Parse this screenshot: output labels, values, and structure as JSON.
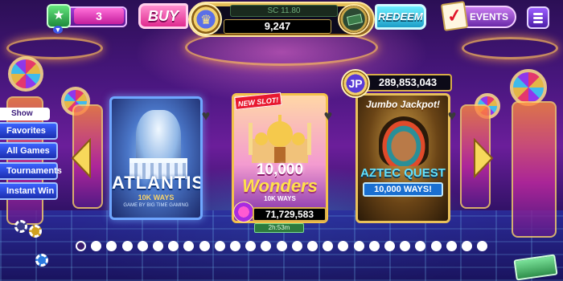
{
  "header": {
    "level": "3",
    "buy_label": "BUY",
    "sc_balance": "SC 11.80",
    "coin_balance": "9,247",
    "redeem_label": "REDEEM",
    "events_label": "EVENTS"
  },
  "side_menu": {
    "show_label": "Show",
    "items": [
      {
        "label": "Favorites"
      },
      {
        "label": "All Games"
      },
      {
        "label": "Tournaments"
      },
      {
        "label": "Instant Win"
      }
    ]
  },
  "games": [
    {
      "title": "ATLANTIS",
      "subtitle": "10K WAYS",
      "brand": "GAME BY BIG TIME GAMING"
    },
    {
      "badge": "NEW SLOT!",
      "title_num": "10,000",
      "title_word": "Wonders",
      "subtitle": "10K WAYS",
      "jackpot": "71,729,583",
      "timer": "2h:53m"
    },
    {
      "jp_badge": "JP",
      "jp_value": "289,853,043",
      "banner": "Jumbo Jackpot!",
      "title": "AZTEC QUEST",
      "subtitle": "10,000 WAYS!"
    }
  ],
  "pagination": {
    "total": 27,
    "active": 0
  },
  "colors": {
    "accent": "#ff3aa8",
    "nav_blue": "#2c45e0",
    "gold": "#d8ad4a"
  },
  "icons": [
    "level-star-icon",
    "coin-icon",
    "cash-icon",
    "events-check-icon",
    "menu-icon",
    "heart-icon",
    "arrow-left-icon",
    "arrow-right-icon"
  ]
}
